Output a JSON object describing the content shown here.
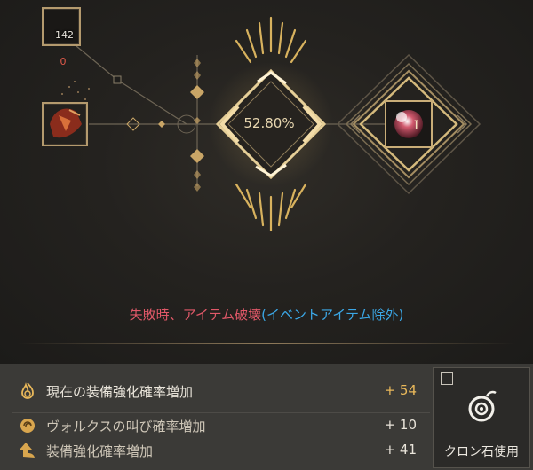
{
  "enhance": {
    "stone_count": "142",
    "stone_owned": "0",
    "success_rate": "52.80%",
    "result_level": "I"
  },
  "warning": {
    "part1": "失敗時、アイテム破壊",
    "part2": "(イベントアイテム除外)"
  },
  "bonus_rows": [
    {
      "icon": "flame-swirl-icon",
      "label": "現在の装備強化確率増加",
      "value": "+ 54"
    },
    {
      "icon": "moon-swirl-icon",
      "label": "ヴォルクスの叫び確率増加",
      "value": "+ 10"
    },
    {
      "icon": "up-arrow-icon",
      "label": "装備強化確率増加",
      "value": "+ 41"
    }
  ],
  "kron": {
    "label": "クロン石使用",
    "checked": false,
    "icon": "kron-stone-icon"
  },
  "colors": {
    "gold": "#e9b85a",
    "warning_red": "#e05868",
    "warning_blue": "#3ba7e6",
    "frame": "#b49a6e"
  }
}
